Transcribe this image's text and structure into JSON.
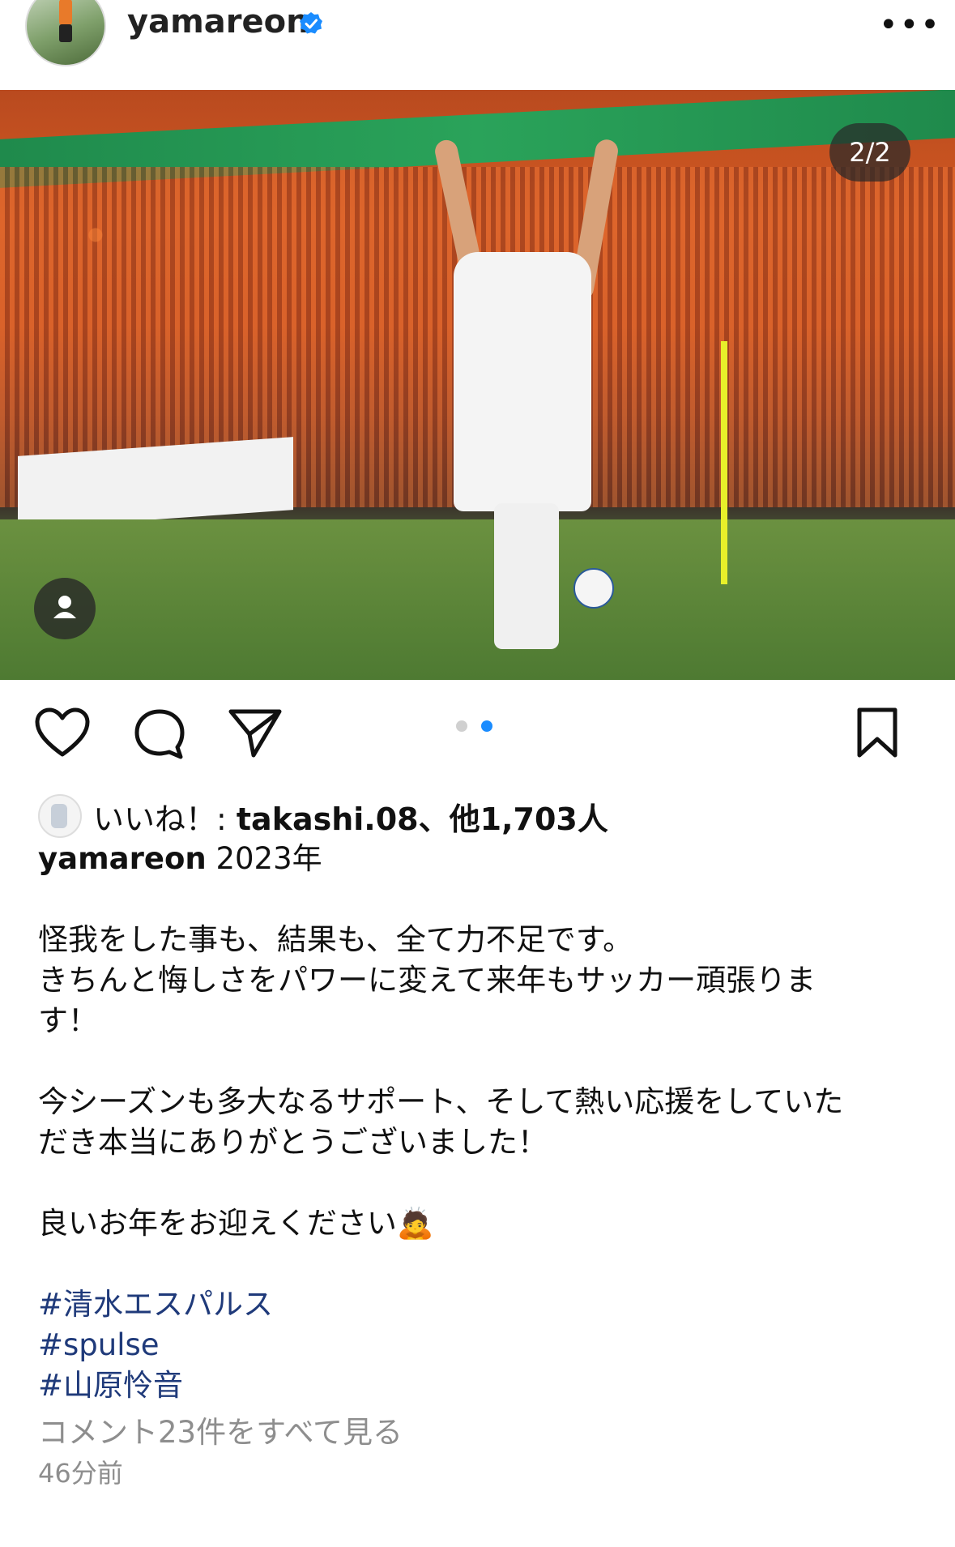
{
  "header": {
    "username": "yamareon",
    "more_label": "•••"
  },
  "photo": {
    "counter": "2/2",
    "current_index": 2,
    "total": 2
  },
  "likes": {
    "prefix": "いいね！: ",
    "liked_by": "takashi.08",
    "suffix": "、他1,703人"
  },
  "caption": {
    "username": "yamareon",
    "year_text": " 2023年",
    "lines": [
      "怪我をした事も、結果も、全て力不足です。",
      "きちんと悔しさをパワーに変えて来年もサッカー頑張りま",
      "す！",
      "今シーズンも多大なるサポート、そして熱い応援をしていた",
      "だき本当にありがとうございました！",
      "良いお年をお迎えください🙇"
    ],
    "hashtags": [
      "#清水エスパルス",
      "#spulse",
      "#山原怜音"
    ]
  },
  "comments_label": "コメント23件をすべて見る",
  "timestamp": "46分前",
  "colors": {
    "accent": "#1a8cff",
    "hashtag": "#1f3a7a",
    "muted": "#8e8e8e"
  },
  "icons": [
    "verified-badge-icon",
    "more-icon",
    "heart-icon",
    "comment-icon",
    "share-icon",
    "bookmark-icon",
    "person-tag-icon"
  ]
}
